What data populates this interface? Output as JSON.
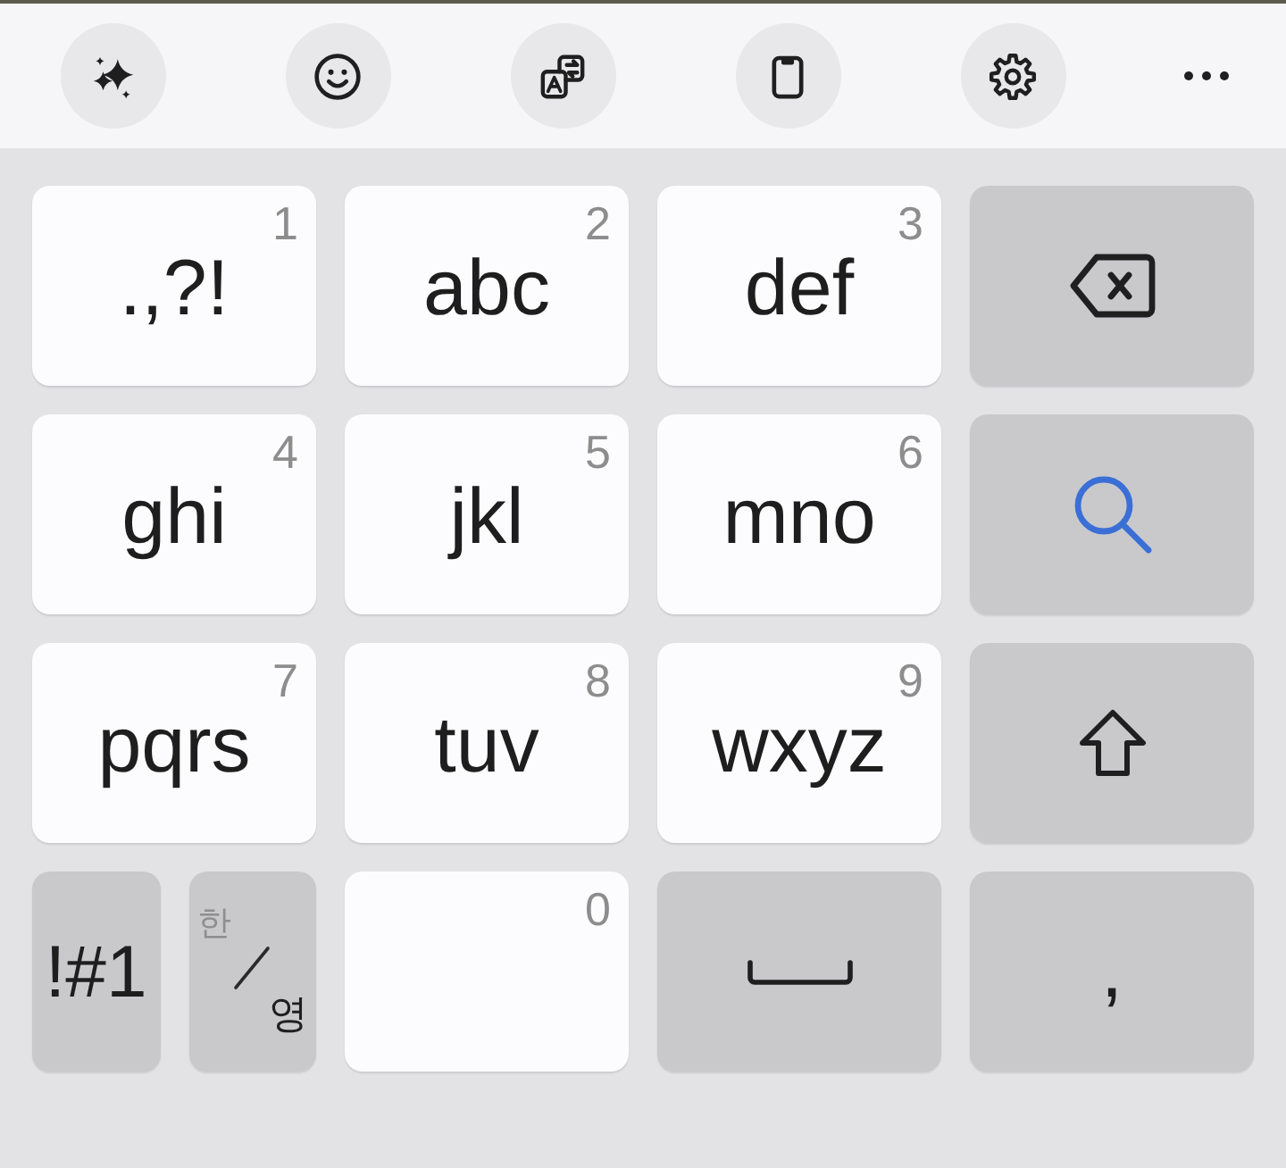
{
  "toolbar": [
    {
      "kind": "sparkle"
    },
    {
      "kind": "emoji"
    },
    {
      "kind": "translate"
    },
    {
      "kind": "clipboard"
    },
    {
      "kind": "settings"
    },
    {
      "kind": "more"
    }
  ],
  "rows": [
    [
      {
        "kind": "letters",
        "label": ".,?!",
        "number": "1"
      },
      {
        "kind": "letters",
        "label": "abc",
        "number": "2"
      },
      {
        "kind": "letters",
        "label": "def",
        "number": "3"
      },
      {
        "kind": "backspace"
      }
    ],
    [
      {
        "kind": "letters",
        "label": "ghi",
        "number": "4"
      },
      {
        "kind": "letters",
        "label": "jkl",
        "number": "5"
      },
      {
        "kind": "letters",
        "label": "mno",
        "number": "6"
      },
      {
        "kind": "search"
      }
    ],
    [
      {
        "kind": "letters",
        "label": "pqrs",
        "number": "7"
      },
      {
        "kind": "letters",
        "label": "tuv",
        "number": "8"
      },
      {
        "kind": "letters",
        "label": "wxyz",
        "number": "9"
      },
      {
        "kind": "shift"
      }
    ],
    [
      {
        "kind": "symbols",
        "label": "!#1"
      },
      {
        "kind": "language",
        "options": [
          {
            "label": "한",
            "selected": false
          },
          {
            "label": "영",
            "selected": true
          }
        ]
      },
      {
        "kind": "digit",
        "number": "0"
      },
      {
        "kind": "space"
      },
      {
        "kind": "punctuation",
        "label": ","
      }
    ]
  ]
}
